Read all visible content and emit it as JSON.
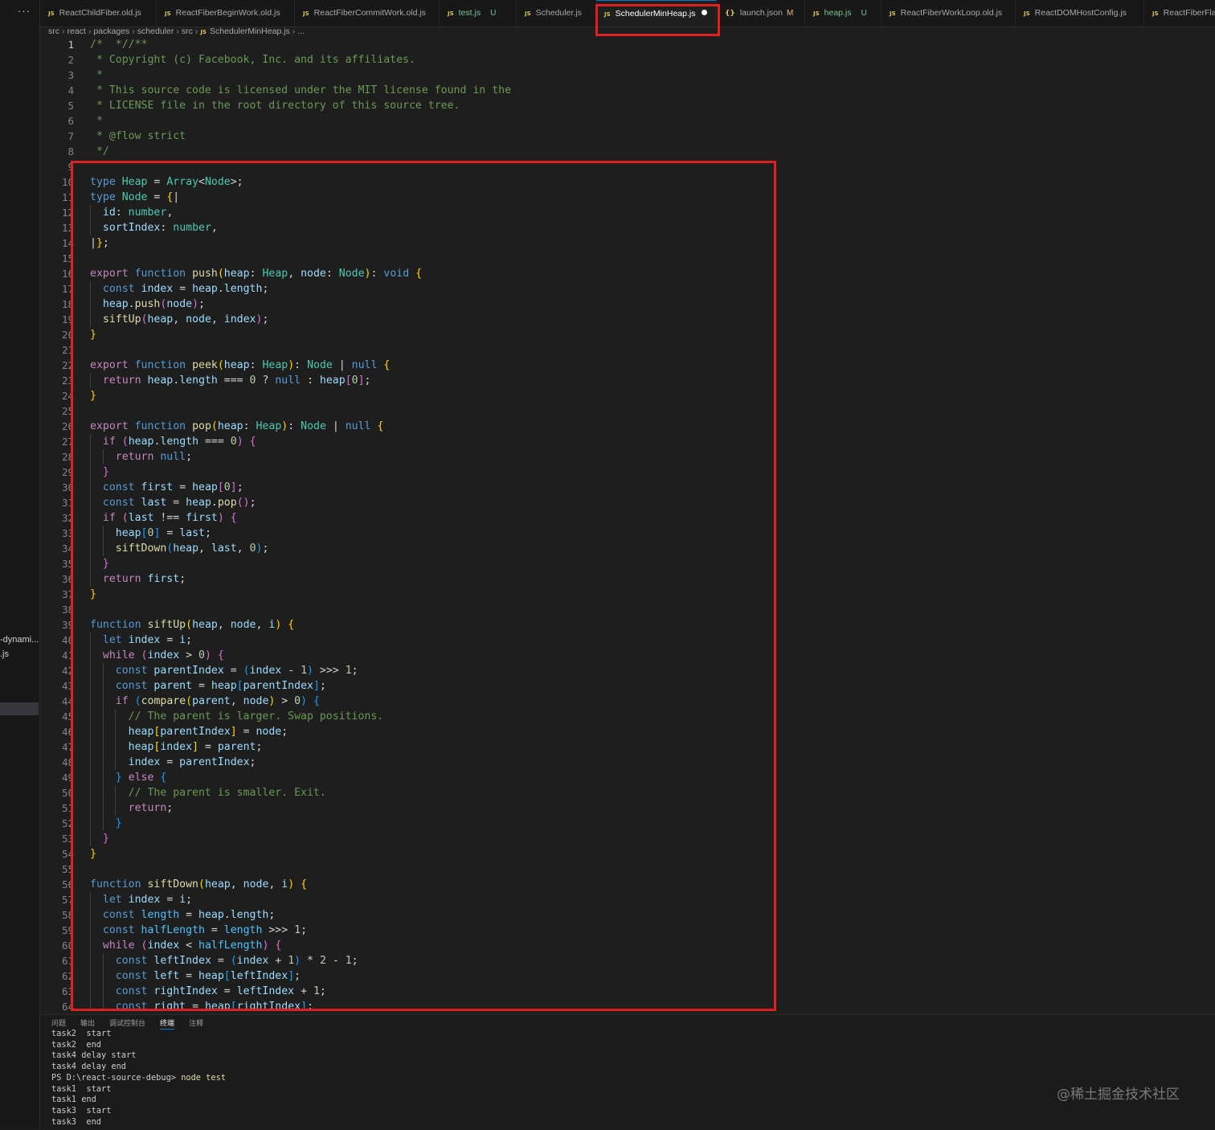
{
  "sidebar": {
    "more_label": "···",
    "partial_file_1": "-dynami...",
    "partial_file_2": ".js"
  },
  "tabs": [
    {
      "label": "ReactChildFiber.old.js",
      "icon": "JS"
    },
    {
      "label": "ReactFiberBeginWork.old.js",
      "icon": "JS"
    },
    {
      "label": "ReactFiberCommitWork.old.js",
      "icon": "JS"
    },
    {
      "label": "test.js",
      "icon": "JS",
      "status": "U"
    },
    {
      "label": "Scheduler.js",
      "icon": "JS"
    },
    {
      "label": "SchedulerMinHeap.js",
      "icon": "JS",
      "active": true,
      "modified": true
    },
    {
      "label": "launch.json",
      "icon": "{}",
      "status": "M"
    },
    {
      "label": "heap.js",
      "icon": "JS",
      "status": "U"
    },
    {
      "label": "ReactFiberWorkLoop.old.js",
      "icon": "JS"
    },
    {
      "label": "ReactDOMHostConfig.js",
      "icon": "JS"
    },
    {
      "label": "ReactFiberFlag",
      "icon": "JS"
    }
  ],
  "breadcrumb": [
    "src",
    "react",
    "packages",
    "scheduler",
    "src",
    "SchedulerMinHeap.js",
    "..."
  ],
  "editor": {
    "line_numbers": [
      "1",
      "2",
      "3",
      "4",
      "5",
      "6",
      "7",
      "8",
      "9",
      "10",
      "11",
      "12",
      "13",
      "14",
      "15",
      "16",
      "17",
      "18",
      "19",
      "20",
      "21",
      "22",
      "23",
      "24",
      "25",
      "26",
      "27",
      "28",
      "29",
      "30",
      "31",
      "32",
      "33",
      "34",
      "35",
      "36",
      "37",
      "38",
      "39",
      "40",
      "41",
      "42",
      "43",
      "44",
      "45",
      "46",
      "47",
      "48",
      "49",
      "50",
      "51",
      "52",
      "53",
      "54",
      "55",
      "56",
      "57",
      "58",
      "59",
      "60",
      "61",
      "62",
      "63",
      "64"
    ],
    "lines": [
      "/*  *//**",
      " * Copyright (c) Facebook, Inc. and its affiliates.",
      " *",
      " * This source code is licensed under the MIT license found in the",
      " * LICENSE file in the root directory of this source tree.",
      " *",
      " * @flow strict",
      " */",
      "",
      "type Heap = Array<Node>;",
      "type Node = {|",
      "  id: number,",
      "  sortIndex: number,",
      "|};",
      "",
      "export function push(heap: Heap, node: Node): void {",
      "  const index = heap.length;",
      "  heap.push(node);",
      "  siftUp(heap, node, index);",
      "}",
      "",
      "export function peek(heap: Heap): Node | null {",
      "  return heap.length === 0 ? null : heap[0];",
      "}",
      "",
      "export function pop(heap: Heap): Node | null {",
      "  if (heap.length === 0) {",
      "    return null;",
      "  }",
      "  const first = heap[0];",
      "  const last = heap.pop();",
      "  if (last !== first) {",
      "    heap[0] = last;",
      "    siftDown(heap, last, 0);",
      "  }",
      "  return first;",
      "}",
      "",
      "function siftUp(heap, node, i) {",
      "  let index = i;",
      "  while (index > 0) {",
      "    const parentIndex = (index - 1) >>> 1;",
      "    const parent = heap[parentIndex];",
      "    if (compare(parent, node) > 0) {",
      "      // The parent is larger. Swap positions.",
      "      heap[parentIndex] = node;",
      "      heap[index] = parent;",
      "      index = parentIndex;",
      "    } else {",
      "      // The parent is smaller. Exit.",
      "      return;",
      "    }",
      "  }",
      "}",
      "",
      "function siftDown(heap, node, i) {",
      "  let index = i;",
      "  const length = heap.length;",
      "  const halfLength = length >>> 1;",
      "  while (index < halfLength) {",
      "    const leftIndex = (index + 1) * 2 - 1;",
      "    const left = heap[leftIndex];",
      "    const rightIndex = leftIndex + 1;",
      "    const right = heap[rightIndex];"
    ]
  },
  "panel": {
    "tabs": [
      "问题",
      "输出",
      "调试控制台",
      "终端",
      "注释"
    ],
    "active_tab": "终端",
    "terminal_lines": [
      {
        "text": "task2  start"
      },
      {
        "text": "task2  end"
      },
      {
        "text": "task4 delay start"
      },
      {
        "text": "task4 delay end"
      },
      {
        "prompt": "PS D:\\react-source-debug> ",
        "command": "node test"
      },
      {
        "text": "task1  start"
      },
      {
        "text": "task1 end"
      },
      {
        "text": "task3  start"
      },
      {
        "text": "task3  end"
      }
    ]
  },
  "watermark": "@稀土掘金技术社区",
  "colors": {
    "annotation_box": "#e02020",
    "accent": "#0078d4",
    "editor_bg": "#1e1e1e"
  }
}
